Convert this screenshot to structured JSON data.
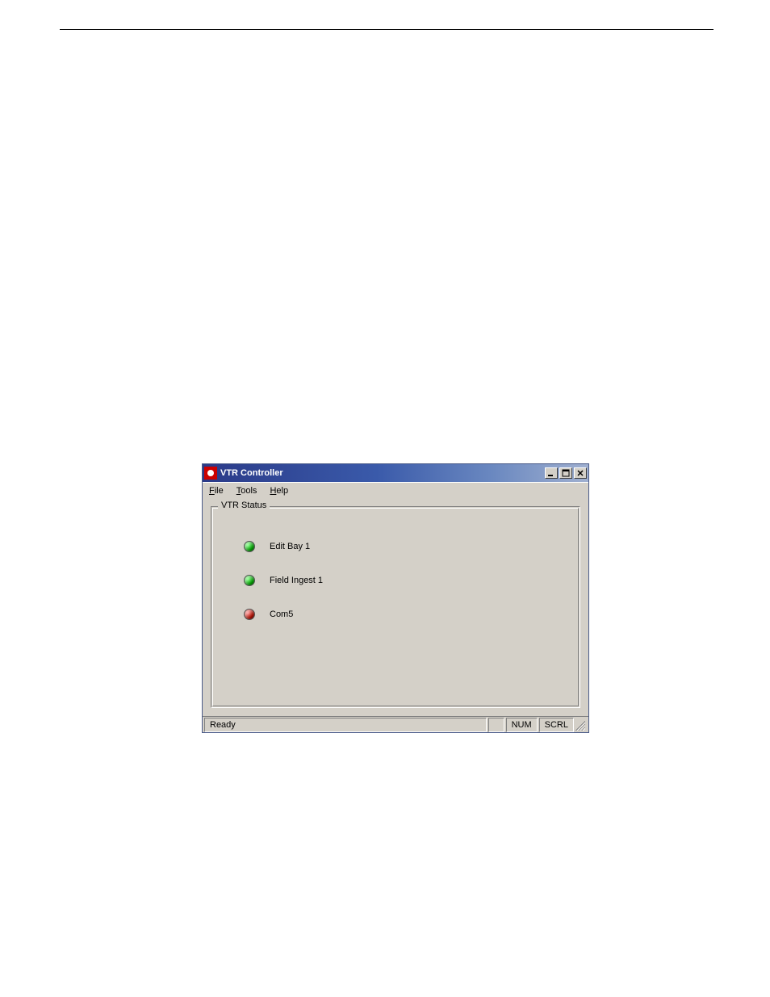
{
  "window": {
    "title": "VTR Controller",
    "menu": {
      "file": "File",
      "file_accel": "F",
      "tools": "Tools",
      "tools_accel": "T",
      "help": "Help",
      "help_accel": "H"
    }
  },
  "groupbox": {
    "title": "VTR Status"
  },
  "vtr_status": [
    {
      "label": "Edit Bay 1",
      "status": "ok",
      "color": "green"
    },
    {
      "label": "Field Ingest 1",
      "status": "ok",
      "color": "green"
    },
    {
      "label": "Com5",
      "status": "error",
      "color": "red"
    }
  ],
  "statusbar": {
    "left": "Ready",
    "num": "NUM",
    "scrl": "SCRL"
  }
}
